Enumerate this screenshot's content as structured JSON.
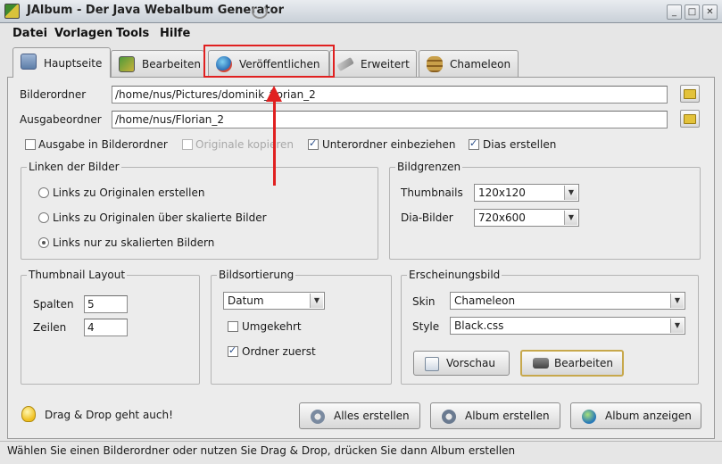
{
  "window": {
    "title": "JAlbum - Der Java Webalbum Generator",
    "controls": {
      "minimize": "_",
      "maximize": "□",
      "close": "✕"
    }
  },
  "menu": [
    "Datei",
    "Vorlagen",
    "Tools",
    "Hilfe"
  ],
  "tabs": [
    {
      "label": "Hauptseite",
      "icon": "home-icon",
      "active": true
    },
    {
      "label": "Bearbeiten",
      "icon": "edit-icon",
      "active": false
    },
    {
      "label": "Veröffentlichen",
      "icon": "globe-icon",
      "active": false,
      "highlighted": true
    },
    {
      "label": "Erweitert",
      "icon": "wrench-icon",
      "active": false
    },
    {
      "label": "Chameleon",
      "icon": "chameleon-icon",
      "active": false
    }
  ],
  "folders": {
    "source_label": "Bilderordner",
    "source_value": "/home/nus/Pictures/dominik_florian_2",
    "output_label": "Ausgabeordner",
    "output_value": "/home/nus/Florian_2"
  },
  "options": {
    "output_in_source": {
      "label": "Ausgabe in Bilderordner",
      "checked": false
    },
    "copy_originals": {
      "label": "Originale kopieren",
      "checked": false,
      "disabled": true
    },
    "include_subfolders": {
      "label": "Unterordner einbeziehen",
      "checked": true
    },
    "create_slides": {
      "label": "Dias erstellen",
      "checked": true
    }
  },
  "linking": {
    "title": "Linken der Bilder",
    "options": [
      {
        "label": "Links zu Originalen erstellen",
        "selected": false
      },
      {
        "label": "Links zu Originalen über skalierte Bilder",
        "selected": false
      },
      {
        "label": "Links nur zu skalierten Bildern",
        "selected": true
      }
    ]
  },
  "bounds": {
    "title": "Bildgrenzen",
    "thumbnails_label": "Thumbnails",
    "thumbnails_value": "120x120",
    "slides_label": "Dia-Bilder",
    "slides_value": "720x600"
  },
  "thumb_layout": {
    "title": "Thumbnail Layout",
    "columns_label": "Spalten",
    "columns_value": "5",
    "rows_label": "Zeilen",
    "rows_value": "4"
  },
  "sorting": {
    "title": "Bildsortierung",
    "sort_value": "Datum",
    "reverse": {
      "label": "Umgekehrt",
      "checked": false
    },
    "folders_first": {
      "label": "Ordner zuerst",
      "checked": true
    }
  },
  "appearance": {
    "title": "Erscheinungsbild",
    "skin_label": "Skin",
    "skin_value": "Chameleon",
    "style_label": "Style",
    "style_value": "Black.css",
    "preview_button": "Vorschau",
    "edit_button": "Bearbeiten"
  },
  "footer": {
    "tip": "Drag & Drop geht auch!",
    "create_all": "Alles erstellen",
    "create_album": "Album erstellen",
    "show_album": "Album anzeigen"
  },
  "status": "Wählen Sie einen Bilderordner oder nutzen Sie Drag & Drop, drücken Sie dann Album erstellen",
  "colors": {
    "annotation": "#e02020",
    "accent": "#c7a84c"
  }
}
